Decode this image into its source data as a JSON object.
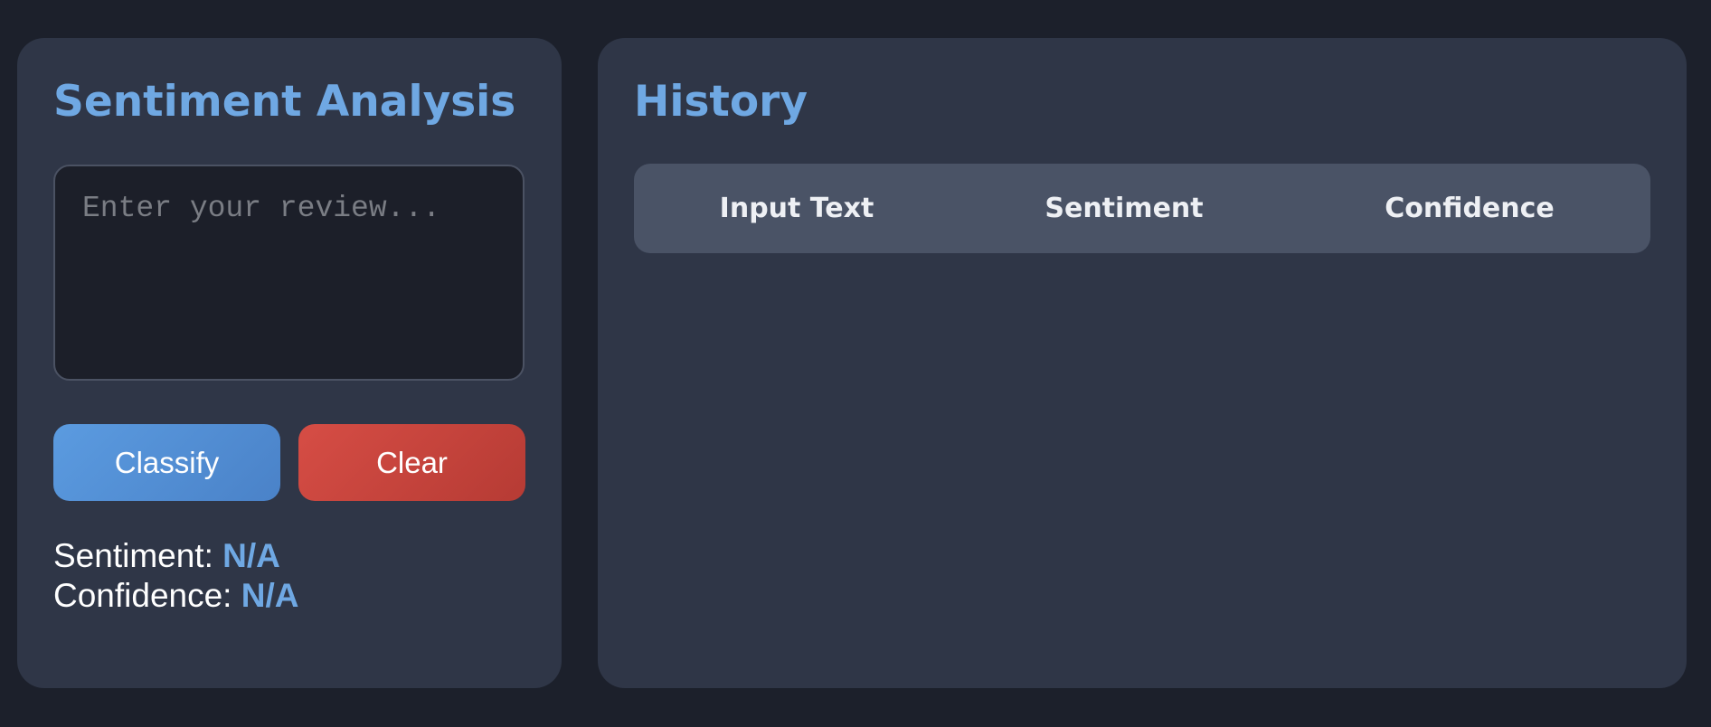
{
  "sentiment_panel": {
    "title": "Sentiment Analysis",
    "review_placeholder": "Enter your review...",
    "review_value": "",
    "classify_label": "Classify",
    "clear_label": "Clear",
    "sentiment_label": "Sentiment: ",
    "sentiment_value": "N/A",
    "confidence_label": "Confidence: ",
    "confidence_value": "N/A"
  },
  "history_panel": {
    "title": "History",
    "columns": [
      "Input Text",
      "Sentiment",
      "Confidence"
    ],
    "rows": []
  },
  "colors": {
    "background": "#1c202b",
    "panel": "#2f3647",
    "accent": "#6fa8e3",
    "classify_button": "#5b9be0",
    "clear_button": "#d64d45",
    "table_header": "#4a5366"
  }
}
